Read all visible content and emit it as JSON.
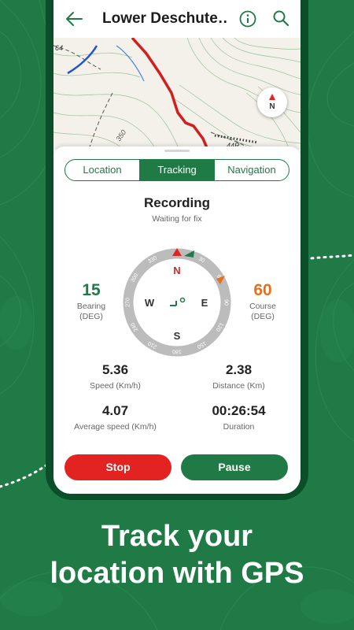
{
  "appbar": {
    "title": "Lower Deschute…",
    "back_icon": "arrow-left-icon",
    "info_icon": "info-circle-icon",
    "search_icon": "search-icon"
  },
  "map": {
    "labels": [
      "64",
      "350",
      "44R"
    ],
    "compass_letter": "N"
  },
  "tabs": [
    {
      "label": "Location",
      "active": false
    },
    {
      "label": "Tracking",
      "active": true
    },
    {
      "label": "Navigation",
      "active": false
    }
  ],
  "recording": {
    "title": "Recording",
    "subtitle": "Waiting for fix"
  },
  "bearing": {
    "value": "15",
    "label": "Bearing",
    "unit": "(DEG)"
  },
  "course": {
    "value": "60",
    "label": "Course",
    "unit": "(DEG)"
  },
  "compass": {
    "letters": {
      "n": "N",
      "e": "E",
      "s": "S",
      "w": "W"
    },
    "ticks": [
      "0",
      "30",
      "60",
      "90",
      "120",
      "150",
      "180",
      "210",
      "240",
      "270",
      "300",
      "330"
    ]
  },
  "stats": [
    {
      "value": "5.36",
      "label": "Speed (Km/h)"
    },
    {
      "value": "2.38",
      "label": "Distance (Km)"
    },
    {
      "value": "4.07",
      "label": "Average speed (Km/h)"
    },
    {
      "value": "00:26:54",
      "label": "Duration"
    }
  ],
  "buttons": {
    "stop": "Stop",
    "pause": "Pause"
  },
  "caption": {
    "line1": "Track your",
    "line2": "location with GPS"
  },
  "colors": {
    "brand_green": "#1f7a45",
    "dark_green": "#0b4f2a",
    "stop_red": "#e32222",
    "course_orange": "#e8701a",
    "bearing_green": "#1f7a45",
    "track_red": "#d21f1f"
  }
}
